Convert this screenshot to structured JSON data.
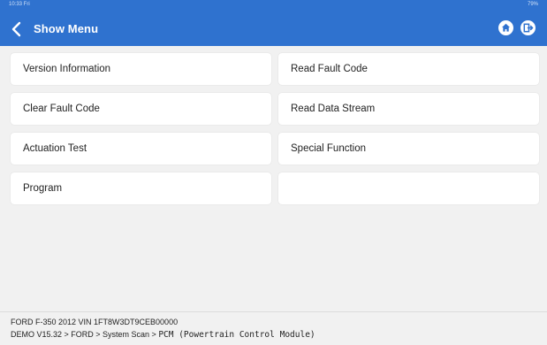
{
  "status_bar": {
    "left": "10:33 Fri",
    "right": "79%"
  },
  "header": {
    "title": "Show Menu"
  },
  "menu": {
    "items": [
      "Version Information",
      "Read Fault Code",
      "Clear Fault Code",
      "Read Data Stream",
      "Actuation Test",
      "Special Function",
      "Program",
      ""
    ]
  },
  "footer": {
    "vehicle_line": "FORD  F-350  2012  VIN  1FT8W3DT9CEB00000",
    "path_prefix": "DEMO V15.32 > FORD > System Scan > ",
    "path_module": "PCM (Powertrain Control Module)"
  },
  "colors": {
    "header_bg": "#2f72cf",
    "page_bg": "#f1f1f1",
    "item_bg": "#ffffff"
  },
  "icons": {
    "back": "chevron-left-icon",
    "home": "home-icon",
    "exit": "exit-icon"
  }
}
